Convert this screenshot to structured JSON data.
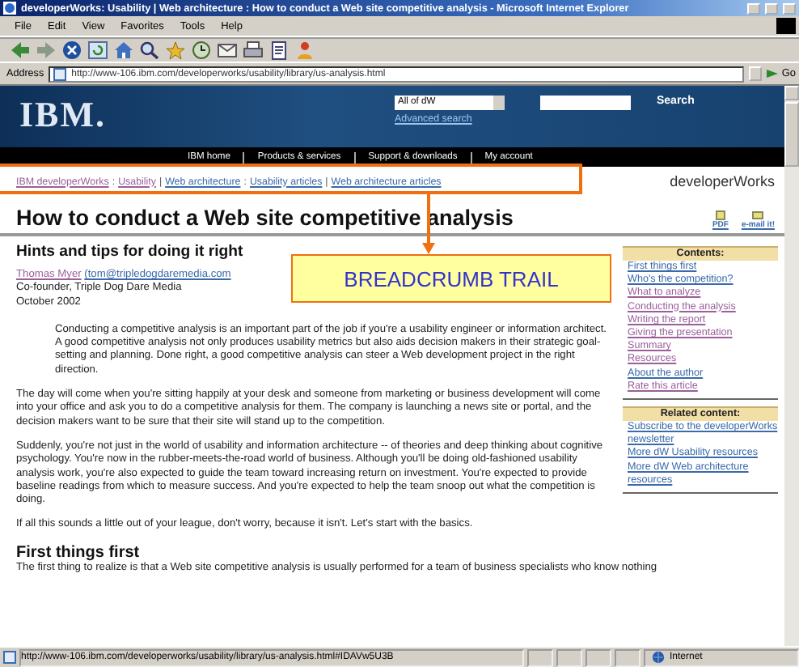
{
  "window": {
    "title": "developerWorks: Usability | Web architecture : How to conduct a Web site competitive analysis - Microsoft Internet Explorer"
  },
  "menu": [
    "File",
    "Edit",
    "View",
    "Favorites",
    "Tools",
    "Help"
  ],
  "address_bar": {
    "label": "Address",
    "value": "http://www-106.ibm.com/developerworks/usability/library/us-analysis.html",
    "go": "Go"
  },
  "site_header": {
    "logo": "IBM.",
    "scope": "All of dW",
    "advanced_search": "Advanced search",
    "search_button": "Search",
    "nav": [
      "IBM home",
      "Products & services",
      "Support & downloads",
      "My account"
    ]
  },
  "breadcrumb": {
    "items": [
      {
        "kind": "link",
        "text": "IBM developerWorks",
        "visited": true
      },
      {
        "kind": "sep",
        "text": ":"
      },
      {
        "kind": "link",
        "text": "Usability",
        "visited": true
      },
      {
        "kind": "sep",
        "text": "|"
      },
      {
        "kind": "link",
        "text": "Web architecture",
        "visited": false
      },
      {
        "kind": "sep",
        "text": ":"
      },
      {
        "kind": "link",
        "text": "Usability articles",
        "visited": false
      },
      {
        "kind": "sep",
        "text": "|"
      },
      {
        "kind": "link",
        "text": "Web architecture articles",
        "visited": false
      }
    ],
    "site_name": "developerWorks"
  },
  "article": {
    "title": "How to conduct a Web site competitive analysis",
    "tools": [
      {
        "kind": "pdf",
        "label": "PDF"
      },
      {
        "kind": "email",
        "label": "e-mail it!"
      }
    ],
    "subtitle": "Hints and tips for doing it right",
    "author": {
      "name": "Thomas Myer",
      "email": "(tom@tripledogdaremedia.com",
      "role": "Co-founder, Triple Dog Dare Media",
      "date": "October 2002"
    },
    "abstract": "Conducting a competitive analysis is an important part of the job if you're a usability engineer or information architect. A good competitive analysis not only produces usability metrics but also aids decision makers in their strategic goal-setting and planning. Done right, a good competitive analysis can steer a Web development project in the right direction.",
    "paragraphs": [
      "The day will come when you're sitting happily at your desk and someone from marketing or business development will come into your office and ask you to do a competitive analysis for them. The company is launching a news site or portal, and the decision makers want to be sure that their site will stand up to the competition.",
      "Suddenly, you're not just in the world of usability and information architecture -- of theories and deep thinking about cognitive psychology. You're now in the rubber-meets-the-road world of business. Although you'll be doing old-fashioned usability analysis work, you're also expected to guide the team toward increasing return on investment. You're expected to provide baseline readings from which to measure success. And you're expected to help the team snoop out what the competition is doing.",
      "If all this sounds a little out of your league, don't worry, because it isn't. Let's start with the basics."
    ],
    "section_heading": "First things first",
    "section_text": "The first thing to realize is that a Web site competitive analysis is usually performed for a team of business specialists who know nothing"
  },
  "sidebar": [
    {
      "heading": "Contents:",
      "links": [
        {
          "text": "First things first",
          "visited": false
        },
        {
          "text": "Who's the competition?",
          "visited": false
        },
        {
          "text": "What to analyze",
          "visited": true
        },
        {
          "text": "Conducting the analysis",
          "visited": true
        },
        {
          "text": "Writing the report",
          "visited": true
        },
        {
          "text": "Giving the presentation",
          "visited": true
        },
        {
          "text": "Summary",
          "visited": true
        },
        {
          "text": "Resources",
          "visited": true
        },
        {
          "text": "About the author",
          "visited": false
        },
        {
          "text": "Rate this article",
          "visited": true
        }
      ]
    },
    {
      "heading": "Related content:",
      "links": [
        {
          "text": "Subscribe to the developerWorks newsletter",
          "visited": false
        },
        {
          "text": "More dW Usability resources",
          "visited": false
        },
        {
          "text": "More dW Web architecture resources",
          "visited": false
        }
      ]
    }
  ],
  "callout": {
    "text": "BREADCRUMB TRAIL"
  },
  "status_bar": {
    "url": "http://www-106.ibm.com/developerworks/usability/library/us-analysis.html#IDAVw5U3B",
    "zone": "Internet"
  }
}
